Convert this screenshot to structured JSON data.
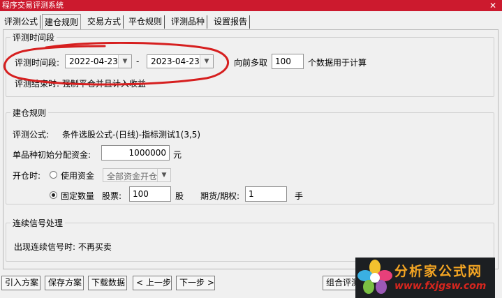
{
  "window": {
    "title": "程序交易评测系统",
    "close_icon": "close-icon"
  },
  "tabs": [
    {
      "label": "评测公式"
    },
    {
      "label": "建仓规则",
      "active": true
    },
    {
      "label": "交易方式"
    },
    {
      "label": "平仓规则"
    },
    {
      "label": "评测品种"
    },
    {
      "label": "设置报告"
    }
  ],
  "period": {
    "group_label": "评测时间段",
    "label": "评测时间段:",
    "start_date": "2022-04-23",
    "dash": "-",
    "end_date": "2023-04-23",
    "lookback_prefix": "向前多取",
    "lookback_value": "100",
    "lookback_suffix": "个数据用于计算",
    "end_note": "评测结束时: 强制平仓并且计入收益"
  },
  "build": {
    "group_label": "建仓规则",
    "formula_label": "评测公式:",
    "formula_value": "条件选股公式-(日线)-指标测试1(3,5)",
    "capital_label": "单品种初始分配资金:",
    "capital_value": "1000000",
    "capital_unit": "元",
    "open_label": "开仓时:",
    "use_capital_label": "使用资金",
    "use_capital_option": "全部资金开仓",
    "fixed_qty_label": "固定数量",
    "stock_label": "股票:",
    "stock_value": "100",
    "stock_unit": "股",
    "futures_label": "期货/期权:",
    "futures_value": "1",
    "futures_unit": "手",
    "selected_mode": "fixed_qty"
  },
  "signal": {
    "group_label": "连续信号处理",
    "text": "出现连续信号时: 不再买卖"
  },
  "buttons": {
    "import": "引入方案",
    "save": "保存方案",
    "download": "下载数据",
    "prev": "< 上一步",
    "next": "下一步 >",
    "combo": "组合评测"
  },
  "watermark": {
    "cn": "分析家公式网",
    "url": "www.fxjgsw.com"
  },
  "colors": {
    "title_bar": "#cc1a2e",
    "annotation": "#d61f1f",
    "watermark_cn": "#f5a623",
    "watermark_url": "#d7261e"
  }
}
